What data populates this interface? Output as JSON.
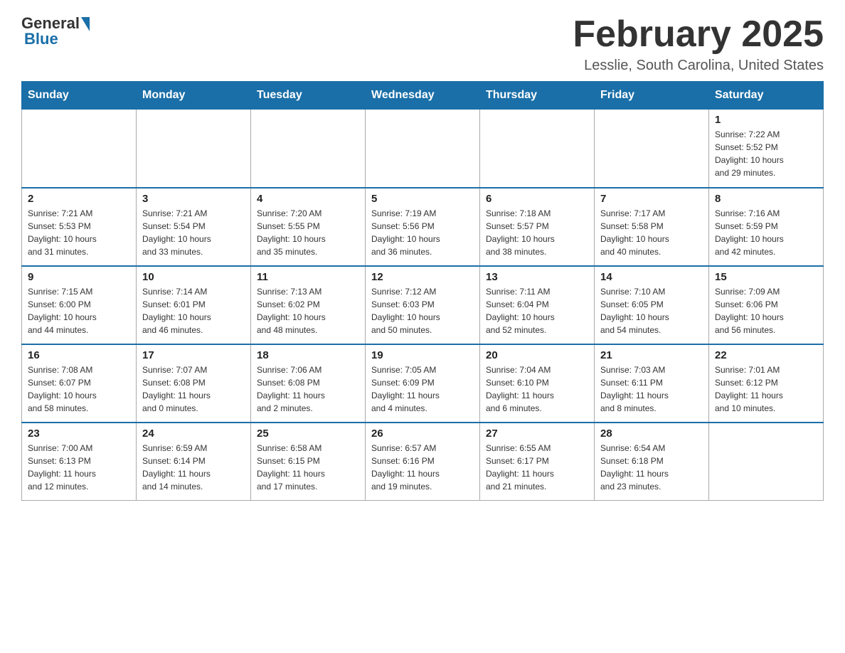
{
  "header": {
    "logo_general": "General",
    "logo_blue": "Blue",
    "month_title": "February 2025",
    "location": "Lesslie, South Carolina, United States"
  },
  "days_of_week": [
    "Sunday",
    "Monday",
    "Tuesday",
    "Wednesday",
    "Thursday",
    "Friday",
    "Saturday"
  ],
  "weeks": [
    [
      {
        "day": "",
        "info": ""
      },
      {
        "day": "",
        "info": ""
      },
      {
        "day": "",
        "info": ""
      },
      {
        "day": "",
        "info": ""
      },
      {
        "day": "",
        "info": ""
      },
      {
        "day": "",
        "info": ""
      },
      {
        "day": "1",
        "info": "Sunrise: 7:22 AM\nSunset: 5:52 PM\nDaylight: 10 hours\nand 29 minutes."
      }
    ],
    [
      {
        "day": "2",
        "info": "Sunrise: 7:21 AM\nSunset: 5:53 PM\nDaylight: 10 hours\nand 31 minutes."
      },
      {
        "day": "3",
        "info": "Sunrise: 7:21 AM\nSunset: 5:54 PM\nDaylight: 10 hours\nand 33 minutes."
      },
      {
        "day": "4",
        "info": "Sunrise: 7:20 AM\nSunset: 5:55 PM\nDaylight: 10 hours\nand 35 minutes."
      },
      {
        "day": "5",
        "info": "Sunrise: 7:19 AM\nSunset: 5:56 PM\nDaylight: 10 hours\nand 36 minutes."
      },
      {
        "day": "6",
        "info": "Sunrise: 7:18 AM\nSunset: 5:57 PM\nDaylight: 10 hours\nand 38 minutes."
      },
      {
        "day": "7",
        "info": "Sunrise: 7:17 AM\nSunset: 5:58 PM\nDaylight: 10 hours\nand 40 minutes."
      },
      {
        "day": "8",
        "info": "Sunrise: 7:16 AM\nSunset: 5:59 PM\nDaylight: 10 hours\nand 42 minutes."
      }
    ],
    [
      {
        "day": "9",
        "info": "Sunrise: 7:15 AM\nSunset: 6:00 PM\nDaylight: 10 hours\nand 44 minutes."
      },
      {
        "day": "10",
        "info": "Sunrise: 7:14 AM\nSunset: 6:01 PM\nDaylight: 10 hours\nand 46 minutes."
      },
      {
        "day": "11",
        "info": "Sunrise: 7:13 AM\nSunset: 6:02 PM\nDaylight: 10 hours\nand 48 minutes."
      },
      {
        "day": "12",
        "info": "Sunrise: 7:12 AM\nSunset: 6:03 PM\nDaylight: 10 hours\nand 50 minutes."
      },
      {
        "day": "13",
        "info": "Sunrise: 7:11 AM\nSunset: 6:04 PM\nDaylight: 10 hours\nand 52 minutes."
      },
      {
        "day": "14",
        "info": "Sunrise: 7:10 AM\nSunset: 6:05 PM\nDaylight: 10 hours\nand 54 minutes."
      },
      {
        "day": "15",
        "info": "Sunrise: 7:09 AM\nSunset: 6:06 PM\nDaylight: 10 hours\nand 56 minutes."
      }
    ],
    [
      {
        "day": "16",
        "info": "Sunrise: 7:08 AM\nSunset: 6:07 PM\nDaylight: 10 hours\nand 58 minutes."
      },
      {
        "day": "17",
        "info": "Sunrise: 7:07 AM\nSunset: 6:08 PM\nDaylight: 11 hours\nand 0 minutes."
      },
      {
        "day": "18",
        "info": "Sunrise: 7:06 AM\nSunset: 6:08 PM\nDaylight: 11 hours\nand 2 minutes."
      },
      {
        "day": "19",
        "info": "Sunrise: 7:05 AM\nSunset: 6:09 PM\nDaylight: 11 hours\nand 4 minutes."
      },
      {
        "day": "20",
        "info": "Sunrise: 7:04 AM\nSunset: 6:10 PM\nDaylight: 11 hours\nand 6 minutes."
      },
      {
        "day": "21",
        "info": "Sunrise: 7:03 AM\nSunset: 6:11 PM\nDaylight: 11 hours\nand 8 minutes."
      },
      {
        "day": "22",
        "info": "Sunrise: 7:01 AM\nSunset: 6:12 PM\nDaylight: 11 hours\nand 10 minutes."
      }
    ],
    [
      {
        "day": "23",
        "info": "Sunrise: 7:00 AM\nSunset: 6:13 PM\nDaylight: 11 hours\nand 12 minutes."
      },
      {
        "day": "24",
        "info": "Sunrise: 6:59 AM\nSunset: 6:14 PM\nDaylight: 11 hours\nand 14 minutes."
      },
      {
        "day": "25",
        "info": "Sunrise: 6:58 AM\nSunset: 6:15 PM\nDaylight: 11 hours\nand 17 minutes."
      },
      {
        "day": "26",
        "info": "Sunrise: 6:57 AM\nSunset: 6:16 PM\nDaylight: 11 hours\nand 19 minutes."
      },
      {
        "day": "27",
        "info": "Sunrise: 6:55 AM\nSunset: 6:17 PM\nDaylight: 11 hours\nand 21 minutes."
      },
      {
        "day": "28",
        "info": "Sunrise: 6:54 AM\nSunset: 6:18 PM\nDaylight: 11 hours\nand 23 minutes."
      },
      {
        "day": "",
        "info": ""
      }
    ]
  ]
}
